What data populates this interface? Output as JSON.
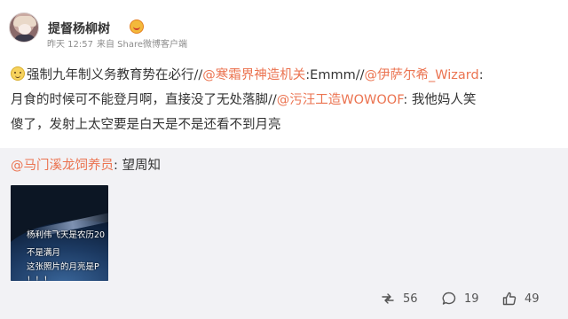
{
  "post": {
    "username": "提督杨柳树",
    "meta_time": "昨天 12:57",
    "meta_source": "来自 Share微博客户端",
    "content": {
      "seg1": "强制九年制义务教育势在必行//",
      "mention1": "@寒霜界神造机关",
      "seg2": ":Emmm//",
      "mention2": "@伊萨尔希_Wizard",
      "seg3": ":",
      "line2_a": "月食的时候可不能登月啊，直接没了无处落脚//",
      "mention3": "@污汪工造WOWOOF",
      "seg4": ": 我他妈人笑",
      "line3": "傻了，发射上太空要是白天是不是还看不到月亮"
    }
  },
  "retweet": {
    "mention": "@马门溪龙饲养员",
    "text": ": 望周知",
    "thumb_lines": [
      "杨利伟飞天是农历20",
      "不是满月",
      "这张照片的月亮是P",
      "！！！"
    ]
  },
  "actions": {
    "forward_count": "56",
    "comment_count": "19",
    "like_count": "49"
  },
  "icons": {
    "forward": "forward-icon",
    "comment": "comment-icon",
    "like": "thumbs-up-icon"
  },
  "colors": {
    "mention": "#eb7350",
    "meta": "#8d8d8d",
    "retweet_bg": "#f2f2f5"
  }
}
